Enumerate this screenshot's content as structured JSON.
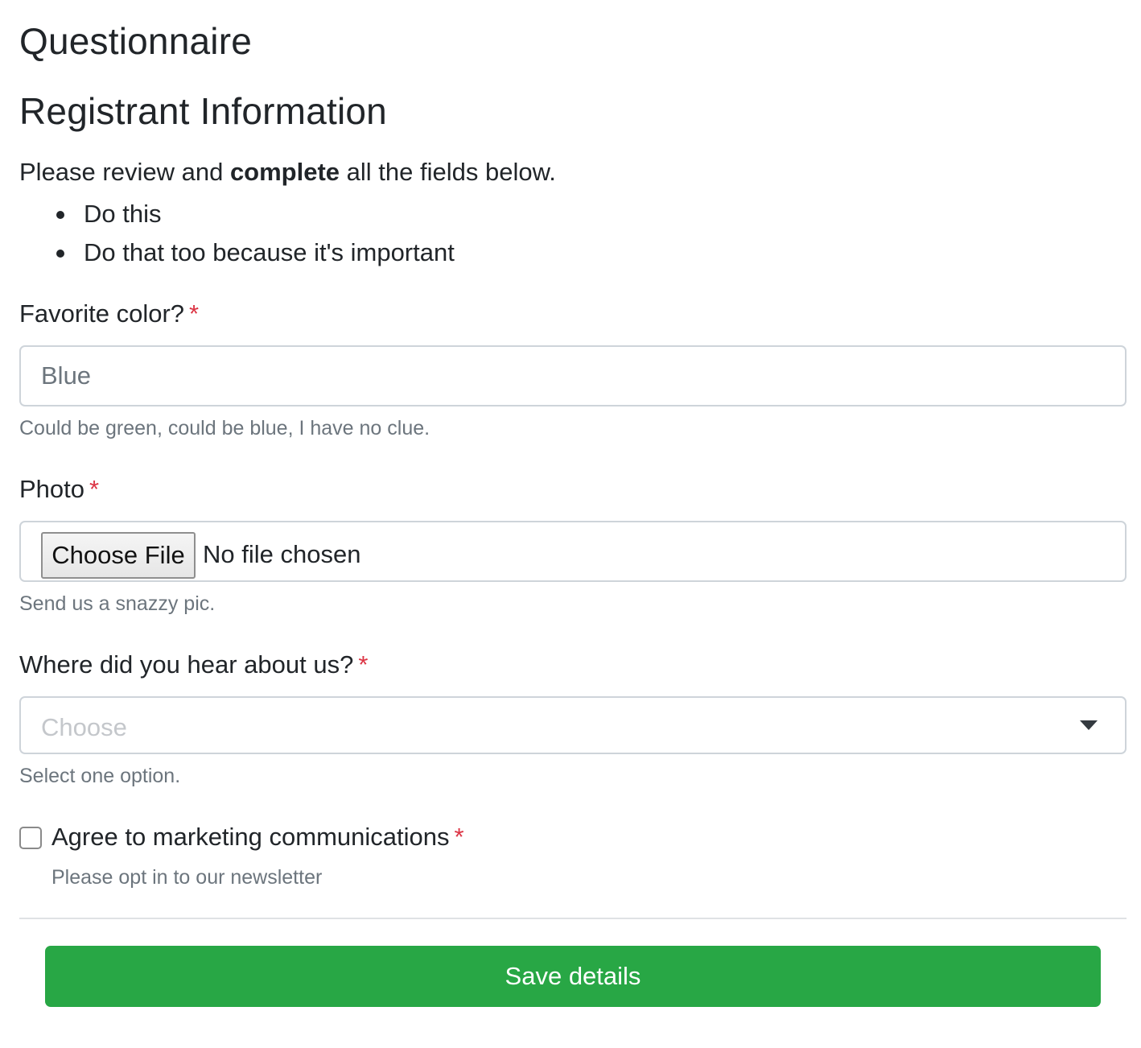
{
  "page": {
    "title": "Questionnaire",
    "section_title": "Registrant Information"
  },
  "intro": {
    "before": "Please review and ",
    "emphasis": "complete",
    "after": " all the fields below.",
    "bullets": [
      "Do this",
      "Do that too because it's important"
    ]
  },
  "fields": {
    "favorite_color": {
      "label": "Favorite color?",
      "required_mark": "*",
      "placeholder": "Blue",
      "value": "",
      "help": "Could be green, could be blue, I have no clue."
    },
    "photo": {
      "label": "Photo",
      "required_mark": "*",
      "button_label": "Choose File",
      "status": "No file chosen",
      "help": "Send us a snazzy pic."
    },
    "source": {
      "label": "Where did you hear about us?",
      "required_mark": "*",
      "selected": "Choose",
      "help": "Select one option."
    },
    "marketing": {
      "label": "Agree to marketing communications",
      "required_mark": "*",
      "checked": false,
      "help": "Please opt in to our newsletter"
    }
  },
  "actions": {
    "save_label": "Save details"
  },
  "colors": {
    "primary_action": "#28a745",
    "required": "#dc3545",
    "muted_text": "#6c757d",
    "border": "#ced4da"
  }
}
